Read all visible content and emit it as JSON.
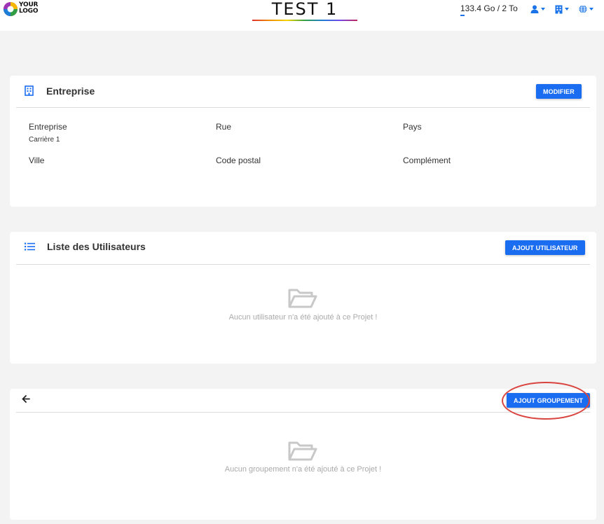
{
  "header": {
    "logo": {
      "line1": "YOUR",
      "line2": "LOGO"
    },
    "title": "TEST 1",
    "storage": "133.4 Go / 2 To",
    "icons": [
      "user-icon",
      "building-icon",
      "globe-icon"
    ]
  },
  "company": {
    "title": "Entreprise",
    "edit_button": "MODIFIER",
    "fields": {
      "entreprise_label": "Entreprise",
      "entreprise_value": "Carrière 1",
      "rue_label": "Rue",
      "pays_label": "Pays",
      "ville_label": "Ville",
      "code_postal_label": "Code postal",
      "complement_label": "Complément"
    }
  },
  "users": {
    "title": "Liste des Utilisateurs",
    "add_button": "AJOUT UTILISATEUR",
    "empty_message": "Aucun utilisateur n'a été ajouté à ce Projet !"
  },
  "groups": {
    "add_button": "AJOUT GROUPEMENT",
    "empty_message": "Aucun groupement n'a été ajouté à ce Projet !"
  },
  "colors": {
    "accent": "#1a6cf0",
    "highlight": "#d9443f",
    "background": "#f3f3f3",
    "empty_text": "#aaaaaa"
  }
}
